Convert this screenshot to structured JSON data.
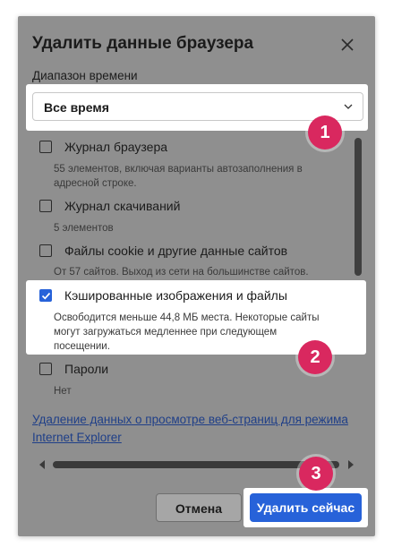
{
  "dialog": {
    "title": "Удалить данные браузера",
    "time_range_label": "Диапазон времени",
    "time_range_value": "Все время",
    "items": [
      {
        "label": "Журнал браузера",
        "desc": "55 элементов, включая варианты автозаполнения в адресной строке.",
        "checked": false
      },
      {
        "label": "Журнал скачиваний",
        "desc": "5 элементов",
        "checked": false
      },
      {
        "label": "Файлы cookie и другие данные сайтов",
        "desc": "От 57 сайтов. Выход из сети на большинстве сайтов.",
        "checked": false
      },
      {
        "label": "Кэшированные изображения и файлы",
        "desc": "Освободится меньше 44,8 МБ места. Некоторые сайты могут загружаться медленнее при следующем посещении.",
        "checked": true
      },
      {
        "label": "Пароли",
        "desc": "Нет",
        "checked": false
      }
    ],
    "ie_link": "Удаление данных о просмотре веб-страниц для режима Internet Explorer",
    "cancel_label": "Отмена",
    "delete_label": "Удалить сейчас"
  },
  "badges": [
    "1",
    "2",
    "3"
  ],
  "colors": {
    "accent": "#2762d9",
    "badge": "#d9285f",
    "overlay": "#8f8f8f"
  },
  "icons": {
    "close": "close-icon",
    "dropdown": "chevron-down-icon",
    "check": "check-icon"
  }
}
